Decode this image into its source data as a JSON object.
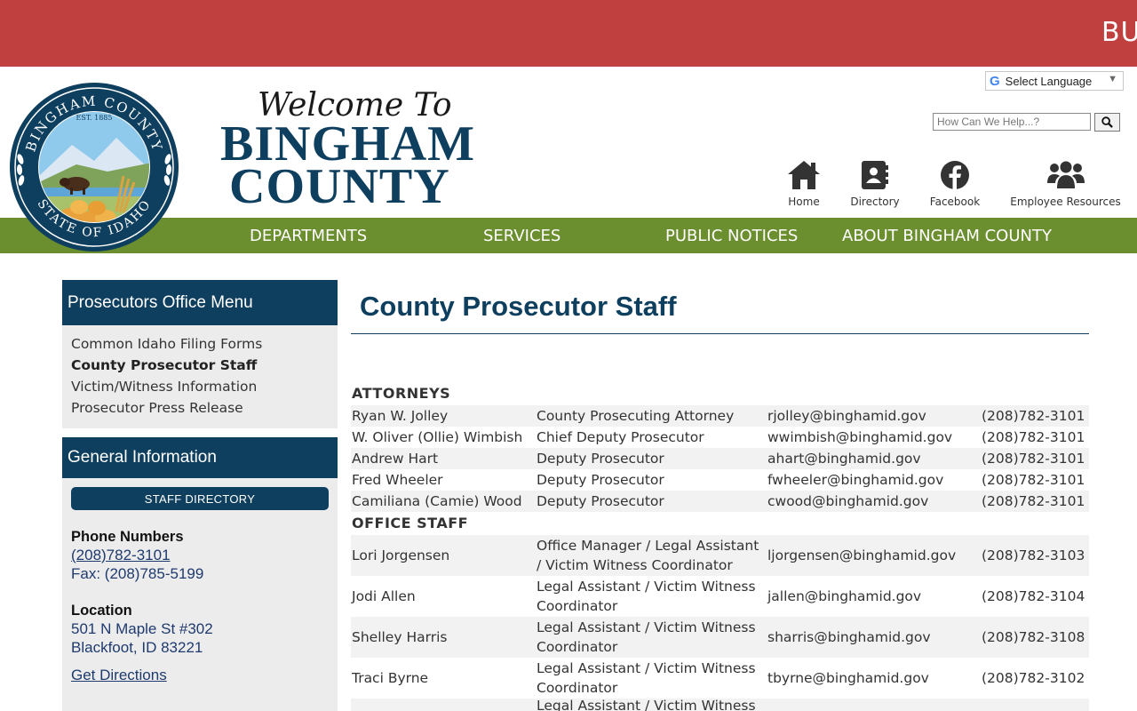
{
  "banner": {
    "text": "BU"
  },
  "header": {
    "welcome": "Welcome To",
    "name_line1": "BINGHAM",
    "name_line2": "COUNTY",
    "seal": {
      "top": "BINGHAM COUNTY",
      "bottom": "STATE OF IDAHO",
      "est": "EST. 1885"
    },
    "language": {
      "label": "Select Language",
      "icon": "google-g-icon"
    },
    "search": {
      "placeholder": "How Can We Help...?",
      "icon": "search-icon"
    },
    "quick_links": [
      {
        "label": "Home",
        "icon": "home-icon"
      },
      {
        "label": "Directory",
        "icon": "address-book-icon"
      },
      {
        "label": "Facebook",
        "icon": "facebook-icon"
      },
      {
        "label": "Employee Resources",
        "icon": "users-icon"
      }
    ]
  },
  "nav": [
    "DEPARTMENTS",
    "SERVICES",
    "PUBLIC NOTICES",
    "ABOUT BINGHAM COUNTY"
  ],
  "sidebar": {
    "menu_title": "Prosecutors Office Menu",
    "menu_items": [
      {
        "label": "Common Idaho Filing Forms",
        "active": false
      },
      {
        "label": "County Prosecutor Staff",
        "active": true
      },
      {
        "label": "Victim/Witness Information",
        "active": false
      },
      {
        "label": "Prosecutor Press Release",
        "active": false
      }
    ],
    "info_title": "General Information",
    "staff_button": "STAFF DIRECTORY",
    "phone_heading": "Phone Numbers",
    "phone": "(208)782-3101",
    "fax": "Fax: (208)785-5199",
    "location_heading": "Location",
    "address1": "501 N Maple St #302",
    "address2": "Blackfoot, ID 83221",
    "directions": "Get Directions"
  },
  "main": {
    "title": "County Prosecutor Staff",
    "attorneys_heading": "ATTORNEYS",
    "attorneys": [
      {
        "name": "Ryan W. Jolley",
        "title": "County Prosecuting Attorney",
        "email": "rjolley@binghamid.gov",
        "phone": "(208)782-3101"
      },
      {
        "name": "W. Oliver (Ollie) Wimbish",
        "title": "Chief Deputy Prosecutor",
        "email": "wwimbish@binghamid.gov",
        "phone": "(208)782-3101"
      },
      {
        "name": "Andrew Hart",
        "title": "Deputy Prosecutor",
        "email": "ahart@binghamid.gov",
        "phone": "(208)782-3101"
      },
      {
        "name": "Fred Wheeler",
        "title": "Deputy Prosecutor",
        "email": "fwheeler@binghamid.gov",
        "phone": "(208)782-3101"
      },
      {
        "name": "Camiliana (Camie) Wood",
        "title": "Deputy Prosecutor",
        "email": "cwood@binghamid.gov",
        "phone": "(208)782-3101"
      }
    ],
    "office_heading": "OFFICE STAFF",
    "office": [
      {
        "name": "Lori Jorgensen",
        "title": "Office Manager / Legal Assistant / Victim Witness Coordinator",
        "email": "ljorgensen@binghamid.gov",
        "phone": "(208)782-3103"
      },
      {
        "name": "Jodi Allen",
        "title": "Legal Assistant / Victim Witness Coordinator",
        "email": "jallen@binghamid.gov",
        "phone": "(208)782-3104"
      },
      {
        "name": "Shelley Harris",
        "title": "Legal Assistant / Victim Witness Coordinator",
        "email": "sharris@binghamid.gov",
        "phone": "(208)782-3108"
      },
      {
        "name": "Traci Byrne",
        "title": "Legal Assistant / Victim Witness Coordinator",
        "email": "tbyrne@binghamid.gov",
        "phone": "(208)782-3102"
      },
      {
        "name": "",
        "title": "Legal Assistant / Victim Witness",
        "email": "",
        "phone": ""
      }
    ]
  }
}
